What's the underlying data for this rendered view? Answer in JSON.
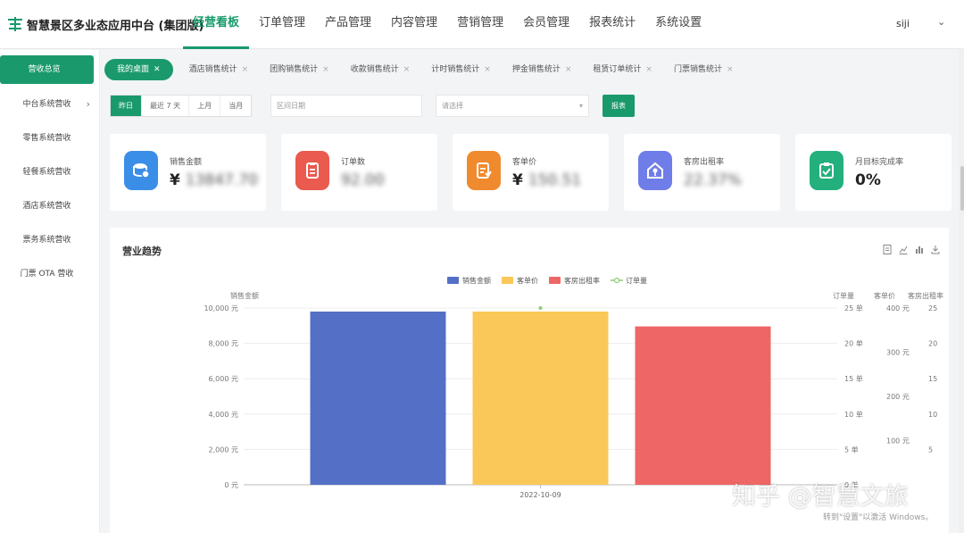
{
  "header": {
    "app_title": "智慧景区多业态应用中台 (集团版)",
    "nav": [
      "经营看板",
      "订单管理",
      "产品管理",
      "内容管理",
      "营销管理",
      "会员管理",
      "报表统计",
      "系统设置"
    ],
    "user": "siji",
    "accent": "#1a9a6c"
  },
  "sidebar": {
    "items": [
      {
        "label": "营收总览"
      },
      {
        "label": "中台系统营收"
      },
      {
        "label": "零售系统营收"
      },
      {
        "label": "轻餐系统营收"
      },
      {
        "label": "酒店系统营收"
      },
      {
        "label": "票务系统营收"
      },
      {
        "label": "门票 OTA 营收"
      }
    ]
  },
  "tabs": [
    "我的桌面",
    "酒店销售统计",
    "团购销售统计",
    "收款销售统计",
    "计时销售统计",
    "押金销售统计",
    "租赁订单统计",
    "门票销售统计"
  ],
  "filters": {
    "ranges": [
      "昨日",
      "最近 7 天",
      "上月",
      "当月"
    ],
    "date_placeholder": "区间日期",
    "select_placeholder": "请选择",
    "query_label": "报表"
  },
  "kpis": [
    {
      "label": "销售金额",
      "prefix": "¥",
      "value": "13847.70",
      "icon": "coins-icon",
      "color": "#3b8ee8"
    },
    {
      "label": "订单数",
      "prefix": "",
      "value": "92.00",
      "icon": "clipboard-icon",
      "color": "#ea5a4e"
    },
    {
      "label": "客单价",
      "prefix": "¥",
      "value": "150.51",
      "icon": "document-icon",
      "color": "#f08a2e"
    },
    {
      "label": "客房出租率",
      "prefix": "",
      "value": "22.37%",
      "icon": "house-key-icon",
      "color": "#6f7de8"
    },
    {
      "label": "月目标完成率",
      "prefix": "",
      "value": "0%",
      "icon": "checklist-icon",
      "color": "#23b07d"
    }
  ],
  "panel": {
    "title": "营业趋势",
    "tools": [
      "document-icon",
      "line-chart-icon",
      "bar-chart-icon",
      "download-icon"
    ]
  },
  "chart_data": {
    "type": "bar",
    "categories": [
      "2022-10-09"
    ],
    "series": [
      {
        "name": "销售金额",
        "values": [
          9800
        ],
        "color": "#5470c6",
        "axis": "销售金额"
      },
      {
        "name": "客单价",
        "values": [
          392
        ],
        "color": "#fac858",
        "axis": "客单价"
      },
      {
        "name": "客房出租率",
        "values": [
          22.4
        ],
        "color": "#ee6666",
        "axis": "客房出租率"
      },
      {
        "name": "订单量",
        "values": [
          25
        ],
        "color": "#91cc75",
        "type": "line",
        "axis": "订单量"
      }
    ],
    "axes": {
      "left": {
        "label": "销售金额",
        "ticks": [
          "10,000 元",
          "8,000 元",
          "6,000 元",
          "4,000 元",
          "2,000 元",
          "0 元"
        ],
        "max": 10000
      },
      "right1": {
        "label": "订单量",
        "ticks": [
          "25 单",
          "20 单",
          "15 单",
          "10 单",
          "5 单",
          "0 单"
        ],
        "max": 25
      },
      "right2": {
        "label": "客单价",
        "ticks": [
          "400 元",
          "300 元",
          "200 元",
          "100 元"
        ],
        "max": 400
      },
      "right3": {
        "label": "客房出租率",
        "ticks": [
          "25",
          "20",
          "15",
          "10",
          "5"
        ],
        "max": 25
      }
    },
    "legend_position": "top-center",
    "grid": true
  },
  "watermark": {
    "text": "知乎 @智慧文旅",
    "windows_text": "转到\"设置\"以激活 Windows。"
  }
}
